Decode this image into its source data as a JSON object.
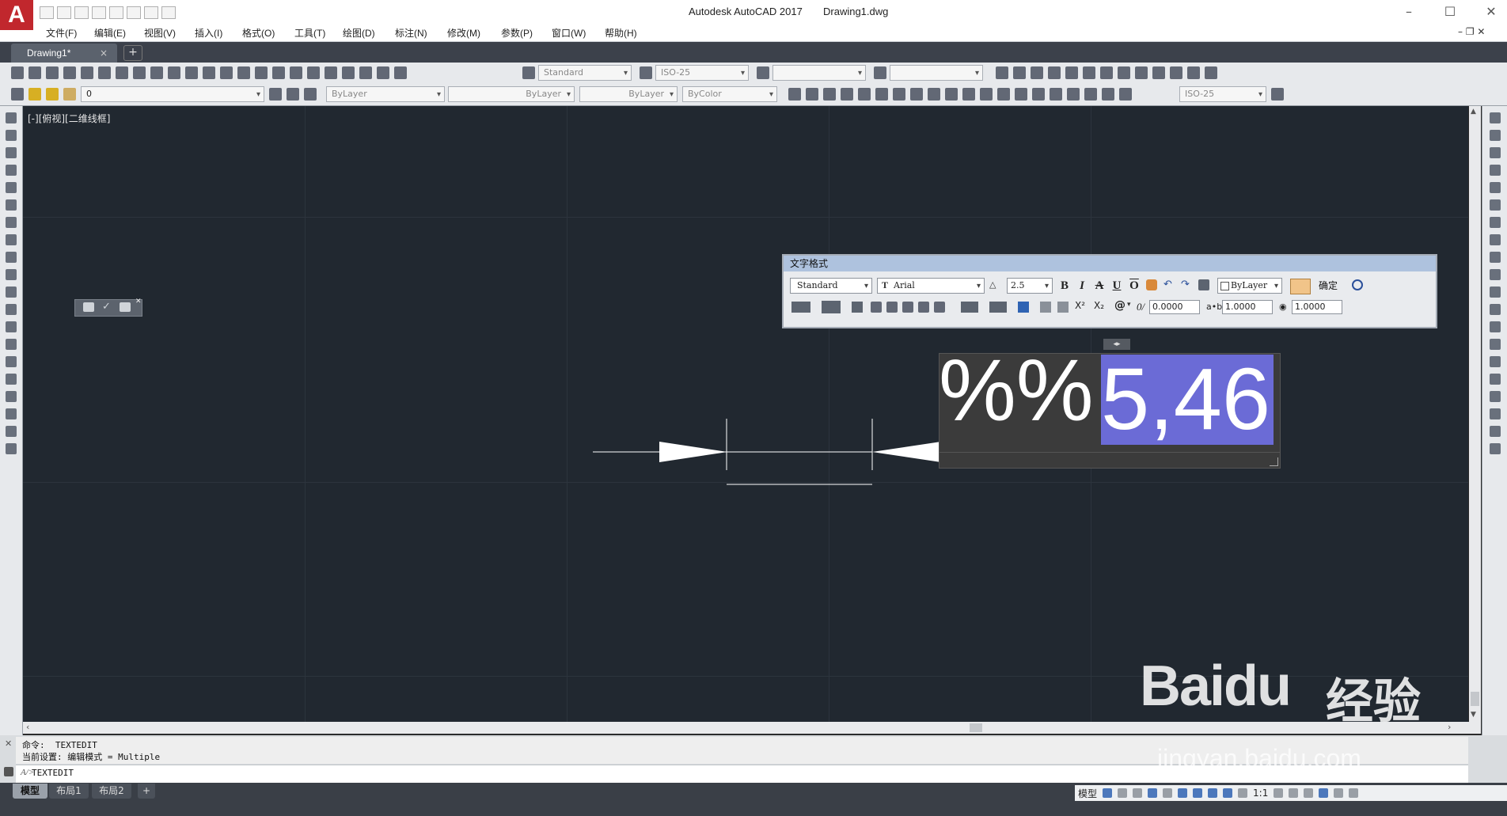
{
  "window": {
    "title": "Autodesk AutoCAD 2017",
    "file": "Drawing1.dwg",
    "logo": "A"
  },
  "menu": [
    "文件(F)",
    "编辑(E)",
    "视图(V)",
    "插入(I)",
    "格式(O)",
    "工具(T)",
    "绘图(D)",
    "标注(N)",
    "修改(M)",
    "参数(P)",
    "窗口(W)",
    "帮助(H)"
  ],
  "tabs": {
    "drawing_tab": "Drawing1*",
    "close": "×",
    "add": "+"
  },
  "toolbar1": {
    "text_style": "Standard",
    "dim_style": "ISO-25"
  },
  "toolbar2": {
    "layer": "0",
    "color": "ByLayer",
    "linetype": "ByLayer",
    "lineweight": "ByLayer",
    "plotstyle": "ByColor",
    "dim_style2": "ISO-25"
  },
  "viewport": {
    "label": "[-][俯视][二维线框]"
  },
  "text_format": {
    "title": "文字格式",
    "style": "Standard",
    "font": "Arial",
    "font_prefix": "T",
    "height": "2.5",
    "bold": "B",
    "italic": "I",
    "strike": "A",
    "underline": "U",
    "overline": "O",
    "color": "ByLayer",
    "ok": "确定",
    "oblique": "0.0000",
    "tracking": "1.0000",
    "width": "1.0000",
    "at": "@",
    "super": "X²",
    "sub": "X₂"
  },
  "editor": {
    "plain_text": "%%",
    "selected_text": "5,46",
    "handle": "◂▸"
  },
  "command": {
    "line1": "命令:  TEXTEDIT",
    "line2": "当前设置: 编辑模式 = Multiple",
    "prompt": "TEXTEDIT"
  },
  "layout_tabs": [
    "模型",
    "布局1",
    "布局2"
  ],
  "layout_add": "+",
  "status": {
    "model": "模型",
    "scale": "1:1"
  },
  "watermark": {
    "logo": "Baidu",
    "cn": "经验",
    "url": "jingyan.baidu.com"
  },
  "colors": {
    "canvas": "#212830",
    "selection": "#6b6bd6",
    "dialog_title": "#aec2de"
  }
}
